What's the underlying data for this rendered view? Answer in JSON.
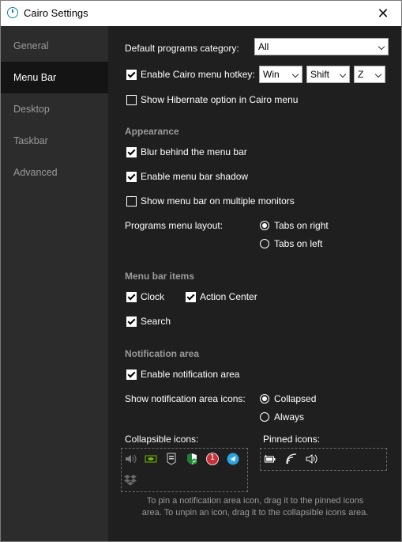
{
  "window": {
    "title": "Cairo Settings",
    "close": "✕"
  },
  "sidebar": {
    "items": [
      {
        "label": "General",
        "active": false
      },
      {
        "label": "Menu Bar",
        "active": true
      },
      {
        "label": "Desktop",
        "active": false
      },
      {
        "label": "Taskbar",
        "active": false
      },
      {
        "label": "Advanced",
        "active": false
      }
    ]
  },
  "menu_bar": {
    "default_programs_label": "Default programs category:",
    "default_programs_value": "All",
    "hotkey": {
      "label": "Enable Cairo menu hotkey:",
      "checked": true,
      "key1": "Win",
      "key2": "Shift",
      "key3": "Z"
    },
    "hibernate": {
      "label": "Show Hibernate option in Cairo menu",
      "checked": false
    }
  },
  "appearance": {
    "header": "Appearance",
    "blur": {
      "label": "Blur behind the menu bar",
      "checked": true
    },
    "shadow": {
      "label": "Enable menu bar shadow",
      "checked": true
    },
    "multi_monitor": {
      "label": "Show menu bar on multiple monitors",
      "checked": false
    },
    "layout_label": "Programs menu layout:",
    "layout_options": [
      {
        "label": "Tabs on right",
        "selected": true
      },
      {
        "label": "Tabs on left",
        "selected": false
      }
    ]
  },
  "menu_bar_items": {
    "header": "Menu bar items",
    "clock": {
      "label": "Clock",
      "checked": true
    },
    "action_center": {
      "label": "Action Center",
      "checked": true
    },
    "search": {
      "label": "Search",
      "checked": true
    }
  },
  "notification_area": {
    "header": "Notification area",
    "enable": {
      "label": "Enable notification area",
      "checked": true
    },
    "icons_label": "Show notification area icons:",
    "icons_options": [
      {
        "label": "Collapsed",
        "selected": true
      },
      {
        "label": "Always",
        "selected": false
      }
    ],
    "collapsible_label": "Collapsible icons:",
    "pinned_label": "Pinned icons:",
    "collapsible_icons": [
      "speaker-icon",
      "nvidia-icon",
      "epic-games-icon",
      "security-shield-icon",
      "notification-badge-icon",
      "telegram-icon",
      "dropbox-icon"
    ],
    "pinned_icons": [
      "battery-icon",
      "wifi-icon",
      "volume-icon"
    ],
    "badge_count": "1",
    "hint": "To pin a notification area icon, drag it to the pinned icons area. To unpin an icon, drag it to the collapsible icons area."
  },
  "colors": {
    "background": "#1f1f1f",
    "sidebar": "#2c2c2c",
    "sidebar_active": "#141414",
    "section_header": "#9a9a9a",
    "telegram": "#2aa3df",
    "badge": "#c7323a",
    "nvidia": "#76b900"
  }
}
